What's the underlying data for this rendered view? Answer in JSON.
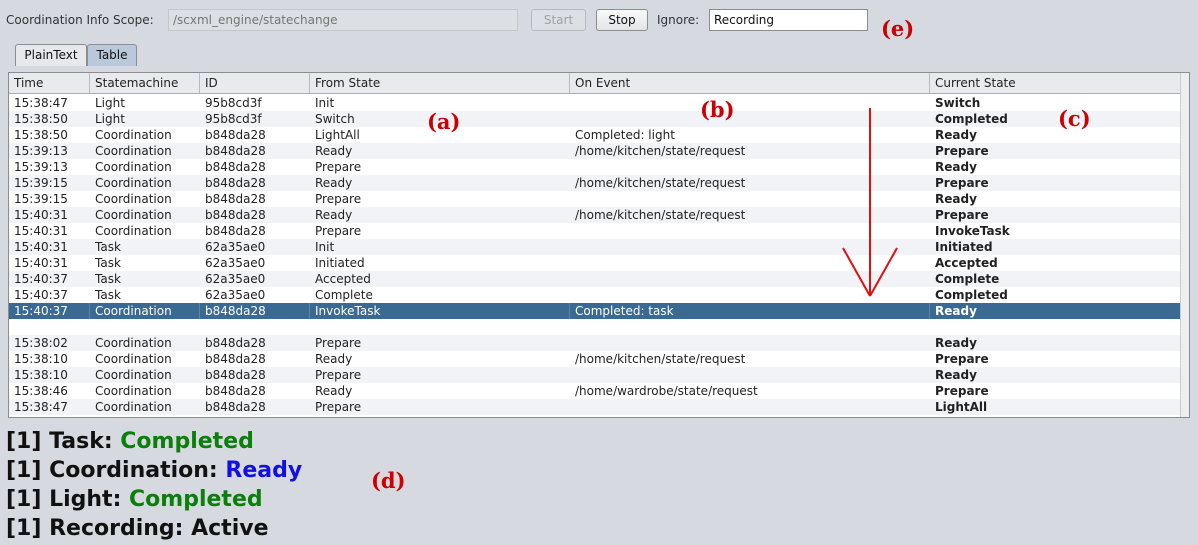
{
  "toolbar": {
    "scope_label": "Coordination Info Scope:",
    "scope_placeholder": "/scxml_engine/statechange",
    "start_label": "Start",
    "stop_label": "Stop",
    "ignore_label": "Ignore:",
    "ignore_value": "Recording"
  },
  "tabs": [
    {
      "label": "PlainText",
      "active": false
    },
    {
      "label": "Table",
      "active": true
    }
  ],
  "table": {
    "columns": [
      "Time",
      "Statemachine",
      "ID",
      "From State",
      "On Event",
      "Current State"
    ],
    "rows": [
      [
        "15:38:47",
        "Light",
        "95b8cd3f",
        "Init",
        "",
        "Switch"
      ],
      [
        "15:38:50",
        "Light",
        "95b8cd3f",
        "Switch",
        "",
        "Completed"
      ],
      [
        "15:38:50",
        "Coordination",
        "b848da28",
        "LightAll",
        "Completed: light",
        "Ready"
      ],
      [
        "15:39:13",
        "Coordination",
        "b848da28",
        "Ready",
        "/home/kitchen/state/request",
        "Prepare"
      ],
      [
        "15:39:13",
        "Coordination",
        "b848da28",
        "Prepare",
        "",
        "Ready"
      ],
      [
        "15:39:15",
        "Coordination",
        "b848da28",
        "Ready",
        "/home/kitchen/state/request",
        "Prepare"
      ],
      [
        "15:39:15",
        "Coordination",
        "b848da28",
        "Prepare",
        "",
        "Ready"
      ],
      [
        "15:40:31",
        "Coordination",
        "b848da28",
        "Ready",
        "/home/kitchen/state/request",
        "Prepare"
      ],
      [
        "15:40:31",
        "Coordination",
        "b848da28",
        "Prepare",
        "",
        "InvokeTask"
      ],
      [
        "15:40:31",
        "Task",
        "62a35ae0",
        "Init",
        "",
        "Initiated"
      ],
      [
        "15:40:31",
        "Task",
        "62a35ae0",
        "Initiated",
        "",
        "Accepted"
      ],
      [
        "15:40:37",
        "Task",
        "62a35ae0",
        "Accepted",
        "",
        "Complete"
      ],
      [
        "15:40:37",
        "Task",
        "62a35ae0",
        "Complete",
        "",
        "Completed"
      ],
      [
        "15:40:37",
        "Coordination",
        "b848da28",
        "InvokeTask",
        "Completed: task",
        "Ready"
      ],
      [
        "",
        "",
        "",
        "",
        "",
        ""
      ],
      [
        "15:38:02",
        "Coordination",
        "b848da28",
        "Prepare",
        "",
        "Ready"
      ],
      [
        "15:38:10",
        "Coordination",
        "b848da28",
        "Ready",
        "/home/kitchen/state/request",
        "Prepare"
      ],
      [
        "15:38:10",
        "Coordination",
        "b848da28",
        "Prepare",
        "",
        "Ready"
      ],
      [
        "15:38:46",
        "Coordination",
        "b848da28",
        "Ready",
        "/home/wardrobe/state/request",
        "Prepare"
      ],
      [
        "15:38:47",
        "Coordination",
        "b848da28",
        "Prepare",
        "",
        "LightAll"
      ]
    ],
    "selected_row": 13
  },
  "annotations": {
    "a": "(a)",
    "b": "(b)",
    "c": "(c)",
    "d": "(d)",
    "e": "(e)"
  },
  "status_lines": [
    {
      "prefix": "[1] Task: ",
      "value": "Completed",
      "color": "#0a7f0a"
    },
    {
      "prefix": "[1] Coordination: ",
      "value": "Ready",
      "color": "#1010e0"
    },
    {
      "prefix": "[1] Light: ",
      "value": "Completed",
      "color": "#0a7f0a"
    },
    {
      "prefix": "[1] Recording: ",
      "value": "Active",
      "color": "#111111"
    }
  ],
  "colors": {
    "selection": "#3a6a93",
    "annotation": "#cc0000",
    "arrow": "#e01010"
  }
}
